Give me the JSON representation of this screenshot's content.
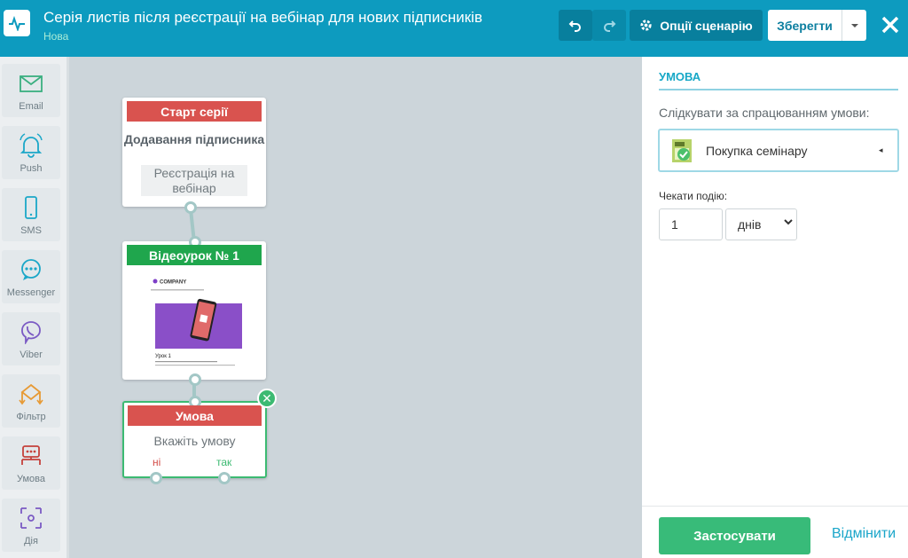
{
  "header": {
    "title": "Серія листів після реєстрації на вебінар для нових підписників",
    "status": "Нова",
    "options_label": "Опції сценарію",
    "save_label": "Зберегти"
  },
  "sidebar": {
    "items": [
      {
        "label": "Email",
        "icon": "email-icon"
      },
      {
        "label": "Push",
        "icon": "bell-icon"
      },
      {
        "label": "SMS",
        "icon": "phone-icon"
      },
      {
        "label": "Messenger",
        "icon": "messenger-icon"
      },
      {
        "label": "Viber",
        "icon": "viber-icon"
      },
      {
        "label": "Фільтр",
        "icon": "filter-icon"
      },
      {
        "label": "Умова",
        "icon": "condition-icon"
      },
      {
        "label": "Дія",
        "icon": "action-icon"
      }
    ]
  },
  "canvas": {
    "start_node": {
      "header": "Старт серії",
      "title": "Додавання підписника",
      "event": "Реєстрація на вебінар"
    },
    "video_node": {
      "header": "Відеоурок № 1",
      "thumb_brand": "COMPANY",
      "thumb_heading": "Урок 1"
    },
    "condition_node": {
      "header": "Умова",
      "prompt": "Вкажіть умову",
      "no_label": "ні",
      "yes_label": "так"
    }
  },
  "panel": {
    "heading": "УМОВА",
    "track_label": "Слідкувати за спрацюванням умови:",
    "event_name": "Покупка семінару",
    "wait_label": "Чекати подію:",
    "wait_value": "1",
    "wait_unit": "днів",
    "apply_label": "Застосувати",
    "cancel_label": "Відмінити"
  },
  "colors": {
    "header_bg": "#0d9bbf",
    "red_header": "#d9534f",
    "green_header": "#1fa64d",
    "accent_green": "#38bb79"
  }
}
